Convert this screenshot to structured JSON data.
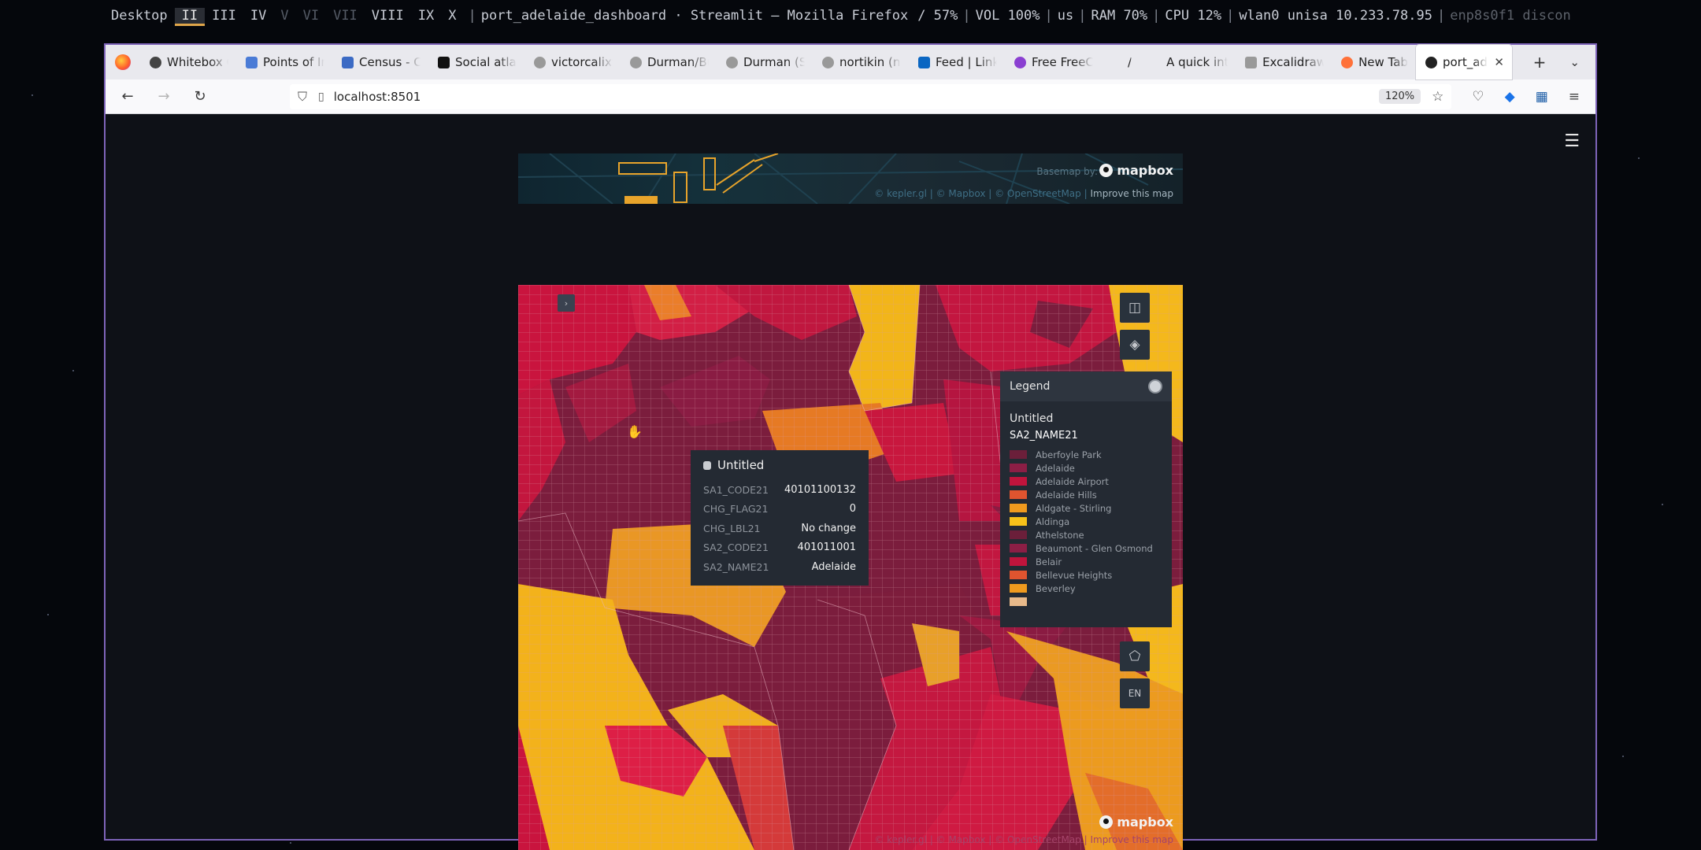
{
  "topbar": {
    "desktop": "Desktop",
    "workspaces": [
      {
        "label": "II",
        "state": "active"
      },
      {
        "label": "III",
        "state": "normal"
      },
      {
        "label": "IV",
        "state": "normal"
      },
      {
        "label": "V",
        "state": "dim"
      },
      {
        "label": "VI",
        "state": "dim"
      },
      {
        "label": "VII",
        "state": "dim"
      },
      {
        "label": "VIII",
        "state": "normal"
      },
      {
        "label": "IX",
        "state": "normal"
      },
      {
        "label": "X",
        "state": "normal"
      }
    ],
    "window_title": "port_adelaide_dashboard · Streamlit — Mozilla Firefox",
    "battery": "/ 57%",
    "volume": "VOL 100%",
    "layout": "us",
    "ram": "RAM 70%",
    "cpu": "CPU 12%",
    "wlan": "wlan0 unisa 10.233.78.95",
    "eth": "enp8s0f1 discon"
  },
  "browser": {
    "tabs": [
      {
        "label": "Whitebox G",
        "icon": "github-icon",
        "color": "#444444"
      },
      {
        "label": "Points of Int",
        "icon": "doc-icon",
        "color": "#4a7bd6"
      },
      {
        "label": "Census - Co",
        "icon": "doc-icon",
        "color": "#3b6ac4"
      },
      {
        "label": "Social atlas",
        "icon": "id-icon",
        "color": "#111111"
      },
      {
        "label": "victorcalixt",
        "icon": "github-icon",
        "color": "#999999"
      },
      {
        "label": "Durman/Bu",
        "icon": "github-icon",
        "color": "#999999"
      },
      {
        "label": "Durman (Se",
        "icon": "github-icon",
        "color": "#999999"
      },
      {
        "label": "nortikin (no",
        "icon": "github-icon",
        "color": "#999999"
      },
      {
        "label": "Feed | Linke",
        "icon": "linkedin-icon",
        "color": "#0a66c2"
      },
      {
        "label": "Free FreeC",
        "icon": "freecad-icon",
        "color": "#8a3fd1"
      },
      {
        "label": "/",
        "icon": "blank-icon",
        "color": "#e9e9ee"
      },
      {
        "label": "A quick introdu",
        "icon": "blank-icon",
        "color": "#e9e9ee"
      },
      {
        "label": "Excalidraw",
        "icon": "excalidraw-icon",
        "color": "#999999"
      },
      {
        "label": "New Tab",
        "icon": "firefox-icon",
        "color": "#ff7139"
      }
    ],
    "active_tab": "port_ade",
    "url": "localhost:8501",
    "zoom": "120%"
  },
  "strip": {
    "basemap_label": "Basemap by:",
    "mapbox": "mapbox",
    "attribution": "© kepler.gl | © Mapbox | © OpenStreetMap |",
    "improve": "Improve this map"
  },
  "map": {
    "mapbox": "mapbox",
    "attribution": "© kepler.gl | © Mapbox | © OpenStreetMap | Improve this map",
    "locale": "EN"
  },
  "legend": {
    "title": "Legend",
    "layer": "Untitled",
    "field": "SA2_NAME21",
    "items": [
      {
        "label": "Aberfoyle Park",
        "color": "#6b1f3a"
      },
      {
        "label": "Adelaide",
        "color": "#8c1e45"
      },
      {
        "label": "Adelaide Airport",
        "color": "#c0143c"
      },
      {
        "label": "Adelaide Hills",
        "color": "#e0542f"
      },
      {
        "label": "Aldgate - Stirling",
        "color": "#f09a1e"
      },
      {
        "label": "Aldinga",
        "color": "#f7c11a"
      },
      {
        "label": "Athelstone",
        "color": "#6b1f3a"
      },
      {
        "label": "Beaumont - Glen Osmond",
        "color": "#8c1e45"
      },
      {
        "label": "Belair",
        "color": "#c0143c"
      },
      {
        "label": "Bellevue Heights",
        "color": "#e0542f"
      },
      {
        "label": "Beverley",
        "color": "#f09a1e"
      },
      {
        "label": "",
        "color": "#e8b98a"
      }
    ]
  },
  "tooltip": {
    "title": "Untitled",
    "rows": [
      {
        "key": "SA1_CODE21",
        "value": "40101100132"
      },
      {
        "key": "CHG_FLAG21",
        "value": "0"
      },
      {
        "key": "CHG_LBL21",
        "value": "No change"
      },
      {
        "key": "SA2_CODE21",
        "value": "401011001"
      },
      {
        "key": "SA2_NAME21",
        "value": "Adelaide"
      }
    ]
  }
}
